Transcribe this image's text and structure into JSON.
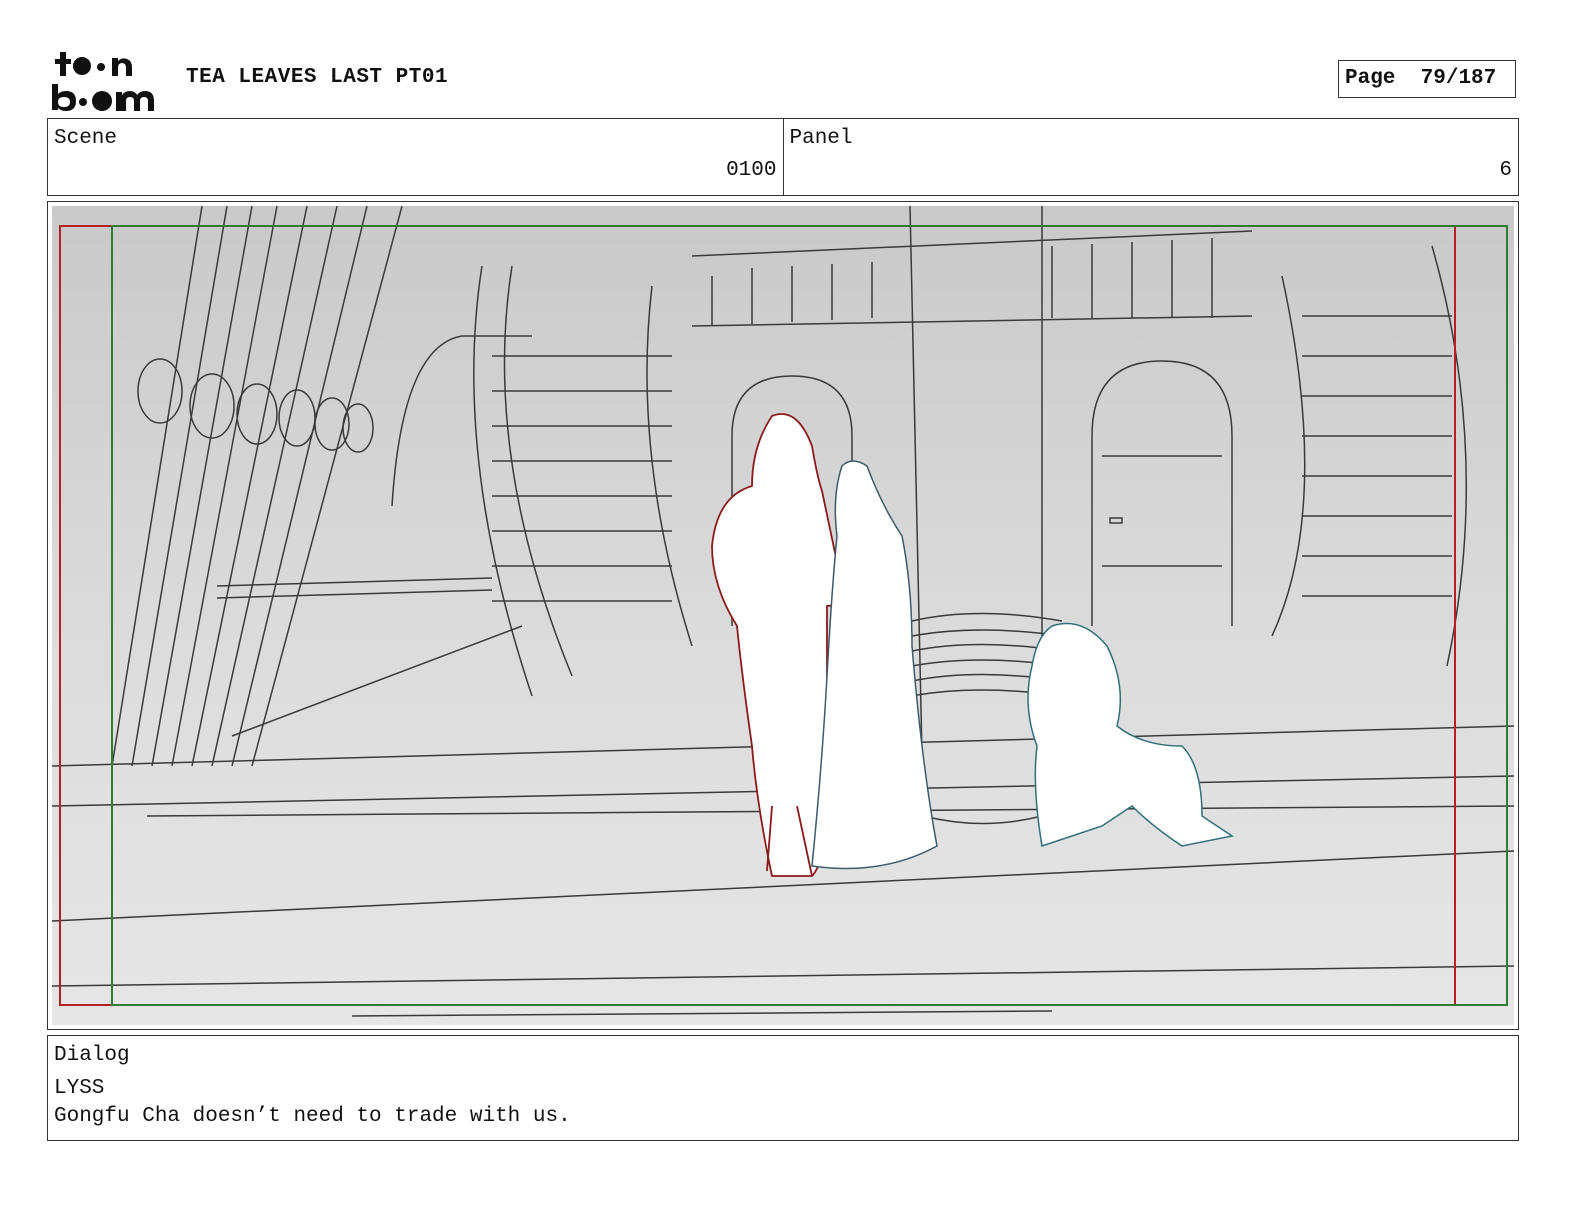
{
  "header": {
    "logo_text": "toon boom",
    "project_title": "TEA LEAVES LAST PT01",
    "page_label": "Page",
    "page_number": "79/187"
  },
  "scene": {
    "label": "Scene",
    "value": "0100"
  },
  "panel": {
    "label": "Panel",
    "value": "6"
  },
  "artwork": {
    "description_icon": "storyboard-panel-image",
    "safe_area_color": "#b22222",
    "action_area_color": "#2e7d32"
  },
  "dialog": {
    "label": "Dialog",
    "speaker": "LYSS",
    "line": "Gongfu Cha doesn’t need to trade with us."
  }
}
